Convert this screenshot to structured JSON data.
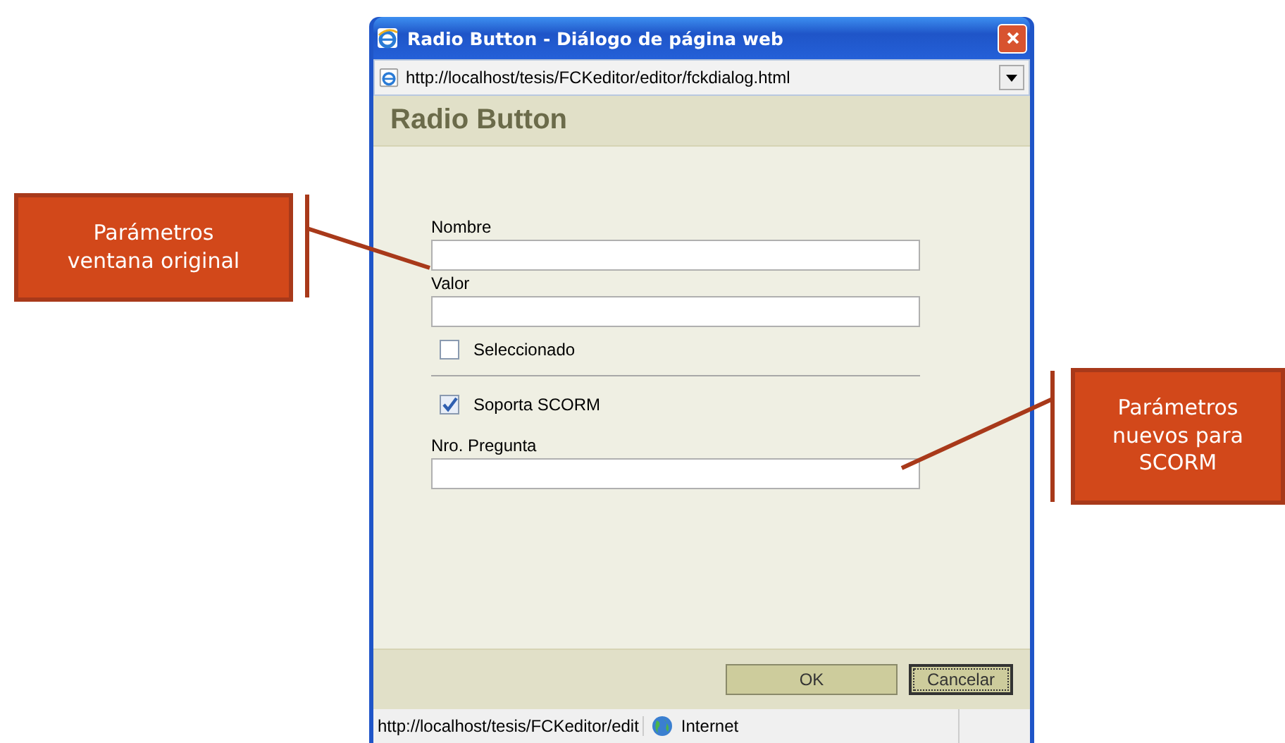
{
  "window": {
    "title": "Radio Button - Diálogo de página web"
  },
  "address_bar": {
    "url": "http://localhost/tesis/FCKeditor/editor/fckdialog.html"
  },
  "dialog": {
    "heading": "Radio Button",
    "fields": [
      {
        "kind": "text",
        "label": "Nombre"
      },
      {
        "kind": "text",
        "label": "Valor"
      },
      {
        "kind": "checkbox",
        "label": "Seleccionado",
        "checked": false
      },
      {
        "kind": "divider"
      },
      {
        "kind": "checkbox",
        "label": "Soporta SCORM",
        "checked": true
      },
      {
        "kind": "text",
        "label": "Nro. Pregunta"
      }
    ],
    "buttons": [
      {
        "label": "OK",
        "focused": false
      },
      {
        "label": "Cancelar",
        "focused": true
      }
    ]
  },
  "status_bar": {
    "url": "http://localhost/tesis/FCKeditor/edit",
    "zone": "Internet"
  },
  "callouts": [
    {
      "text": "Parámetros ventana original",
      "kind": "left"
    },
    {
      "text": "Parámetros nuevos para SCORM",
      "kind": "right"
    }
  ]
}
